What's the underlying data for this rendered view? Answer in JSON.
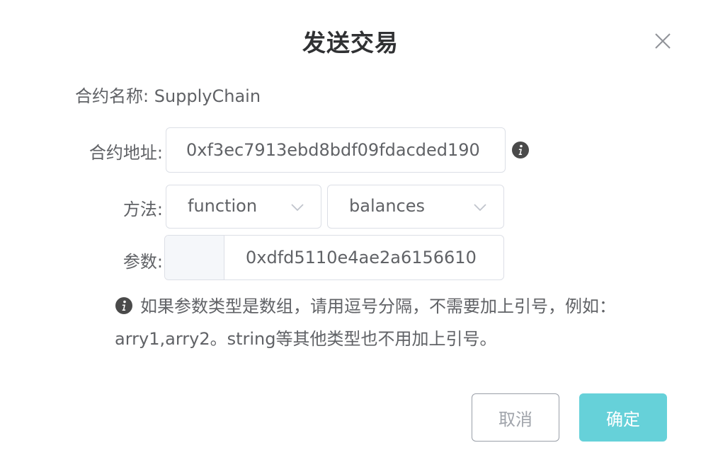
{
  "dialog": {
    "title": "发送交易",
    "close_icon": "close-icon"
  },
  "contract": {
    "name_label": "合约名称: SupplyChain",
    "address_label": "合约地址:",
    "address_value": "0xf3ec7913ebd8bdf09fdacded190",
    "address_info_icon": "info-icon"
  },
  "method": {
    "label": "方法:",
    "type_selected": "function",
    "function_selected": "balances"
  },
  "params": {
    "label": "参数:",
    "prefix": "",
    "value": "0xdfd5110e4ae2a6156610"
  },
  "hint": {
    "icon": "info-icon",
    "text": "如果参数类型是数组，请用逗号分隔，不需要加上引号，例如：arry1,arry2。string等其他类型也不用加上引号。"
  },
  "footer": {
    "cancel_label": "取消",
    "confirm_label": "确定"
  },
  "colors": {
    "primary": "#66d1d9",
    "border": "#dcdfe6",
    "text": "#606266",
    "title": "#303133",
    "info_icon": "#4a4a4a"
  }
}
